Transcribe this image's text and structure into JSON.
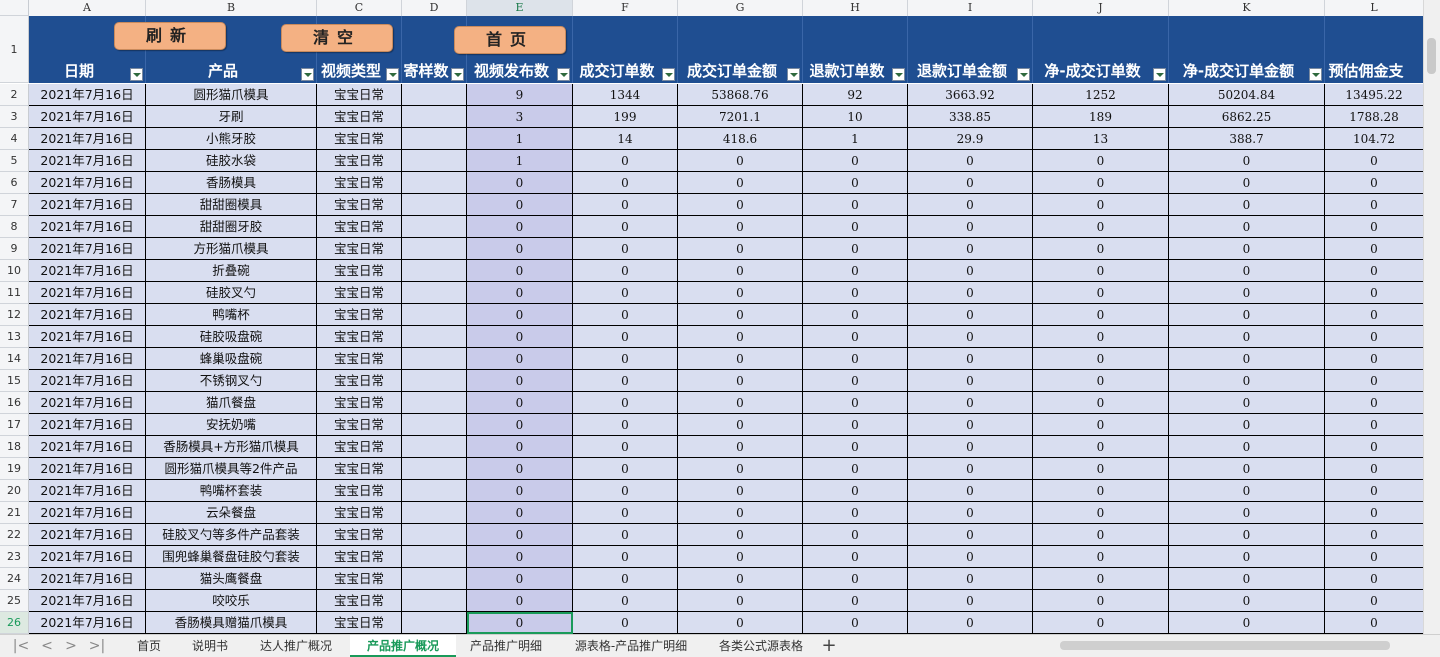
{
  "columns": [
    "A",
    "B",
    "C",
    "D",
    "E",
    "F",
    "G",
    "H",
    "I",
    "J",
    "K",
    "L"
  ],
  "buttons": {
    "refresh": "刷新",
    "clear": "清空",
    "home": "首页"
  },
  "headers": [
    "日期",
    "产品",
    "视频类型",
    "寄样数",
    "视频发布数",
    "成交订单数",
    "成交订单金额",
    "退款订单数",
    "退款订单金额",
    "净-成交订单数",
    "净-成交订单金额",
    "预估佣金支"
  ],
  "header_row_number": "1",
  "rows": [
    {
      "n": "2",
      "date": "2021年7月16日",
      "product": "圆形猫爪模具",
      "type": "宝宝日常",
      "samples": "",
      "videos": "9",
      "orders": "1344",
      "order_amt": "53868.76",
      "refunds": "92",
      "refund_amt": "3663.92",
      "net_orders": "1252",
      "net_amt": "50204.84",
      "commission": "13495.22"
    },
    {
      "n": "3",
      "date": "2021年7月16日",
      "product": "牙刷",
      "type": "宝宝日常",
      "samples": "",
      "videos": "3",
      "orders": "199",
      "order_amt": "7201.1",
      "refunds": "10",
      "refund_amt": "338.85",
      "net_orders": "189",
      "net_amt": "6862.25",
      "commission": "1788.28"
    },
    {
      "n": "4",
      "date": "2021年7月16日",
      "product": "小熊牙胶",
      "type": "宝宝日常",
      "samples": "",
      "videos": "1",
      "orders": "14",
      "order_amt": "418.6",
      "refunds": "1",
      "refund_amt": "29.9",
      "net_orders": "13",
      "net_amt": "388.7",
      "commission": "104.72"
    },
    {
      "n": "5",
      "date": "2021年7月16日",
      "product": "硅胶水袋",
      "type": "宝宝日常",
      "samples": "",
      "videos": "1",
      "orders": "0",
      "order_amt": "0",
      "refunds": "0",
      "refund_amt": "0",
      "net_orders": "0",
      "net_amt": "0",
      "commission": "0"
    },
    {
      "n": "6",
      "date": "2021年7月16日",
      "product": "香肠模具",
      "type": "宝宝日常",
      "samples": "",
      "videos": "0",
      "orders": "0",
      "order_amt": "0",
      "refunds": "0",
      "refund_amt": "0",
      "net_orders": "0",
      "net_amt": "0",
      "commission": "0"
    },
    {
      "n": "7",
      "date": "2021年7月16日",
      "product": "甜甜圈模具",
      "type": "宝宝日常",
      "samples": "",
      "videos": "0",
      "orders": "0",
      "order_amt": "0",
      "refunds": "0",
      "refund_amt": "0",
      "net_orders": "0",
      "net_amt": "0",
      "commission": "0"
    },
    {
      "n": "8",
      "date": "2021年7月16日",
      "product": "甜甜圈牙胶",
      "type": "宝宝日常",
      "samples": "",
      "videos": "0",
      "orders": "0",
      "order_amt": "0",
      "refunds": "0",
      "refund_amt": "0",
      "net_orders": "0",
      "net_amt": "0",
      "commission": "0"
    },
    {
      "n": "9",
      "date": "2021年7月16日",
      "product": "方形猫爪模具",
      "type": "宝宝日常",
      "samples": "",
      "videos": "0",
      "orders": "0",
      "order_amt": "0",
      "refunds": "0",
      "refund_amt": "0",
      "net_orders": "0",
      "net_amt": "0",
      "commission": "0"
    },
    {
      "n": "10",
      "date": "2021年7月16日",
      "product": "折叠碗",
      "type": "宝宝日常",
      "samples": "",
      "videos": "0",
      "orders": "0",
      "order_amt": "0",
      "refunds": "0",
      "refund_amt": "0",
      "net_orders": "0",
      "net_amt": "0",
      "commission": "0"
    },
    {
      "n": "11",
      "date": "2021年7月16日",
      "product": "硅胶叉勺",
      "type": "宝宝日常",
      "samples": "",
      "videos": "0",
      "orders": "0",
      "order_amt": "0",
      "refunds": "0",
      "refund_amt": "0",
      "net_orders": "0",
      "net_amt": "0",
      "commission": "0"
    },
    {
      "n": "12",
      "date": "2021年7月16日",
      "product": "鸭嘴杯",
      "type": "宝宝日常",
      "samples": "",
      "videos": "0",
      "orders": "0",
      "order_amt": "0",
      "refunds": "0",
      "refund_amt": "0",
      "net_orders": "0",
      "net_amt": "0",
      "commission": "0"
    },
    {
      "n": "13",
      "date": "2021年7月16日",
      "product": "硅胶吸盘碗",
      "type": "宝宝日常",
      "samples": "",
      "videos": "0",
      "orders": "0",
      "order_amt": "0",
      "refunds": "0",
      "refund_amt": "0",
      "net_orders": "0",
      "net_amt": "0",
      "commission": "0"
    },
    {
      "n": "14",
      "date": "2021年7月16日",
      "product": "蜂巢吸盘碗",
      "type": "宝宝日常",
      "samples": "",
      "videos": "0",
      "orders": "0",
      "order_amt": "0",
      "refunds": "0",
      "refund_amt": "0",
      "net_orders": "0",
      "net_amt": "0",
      "commission": "0"
    },
    {
      "n": "15",
      "date": "2021年7月16日",
      "product": "不锈钢叉勺",
      "type": "宝宝日常",
      "samples": "",
      "videos": "0",
      "orders": "0",
      "order_amt": "0",
      "refunds": "0",
      "refund_amt": "0",
      "net_orders": "0",
      "net_amt": "0",
      "commission": "0"
    },
    {
      "n": "16",
      "date": "2021年7月16日",
      "product": "猫爪餐盘",
      "type": "宝宝日常",
      "samples": "",
      "videos": "0",
      "orders": "0",
      "order_amt": "0",
      "refunds": "0",
      "refund_amt": "0",
      "net_orders": "0",
      "net_amt": "0",
      "commission": "0"
    },
    {
      "n": "17",
      "date": "2021年7月16日",
      "product": "安抚奶嘴",
      "type": "宝宝日常",
      "samples": "",
      "videos": "0",
      "orders": "0",
      "order_amt": "0",
      "refunds": "0",
      "refund_amt": "0",
      "net_orders": "0",
      "net_amt": "0",
      "commission": "0"
    },
    {
      "n": "18",
      "date": "2021年7月16日",
      "product": "香肠模具+方形猫爪模具",
      "type": "宝宝日常",
      "samples": "",
      "videos": "0",
      "orders": "0",
      "order_amt": "0",
      "refunds": "0",
      "refund_amt": "0",
      "net_orders": "0",
      "net_amt": "0",
      "commission": "0"
    },
    {
      "n": "19",
      "date": "2021年7月16日",
      "product": "圆形猫爪模具等2件产品",
      "type": "宝宝日常",
      "samples": "",
      "videos": "0",
      "orders": "0",
      "order_amt": "0",
      "refunds": "0",
      "refund_amt": "0",
      "net_orders": "0",
      "net_amt": "0",
      "commission": "0"
    },
    {
      "n": "20",
      "date": "2021年7月16日",
      "product": "鸭嘴杯套装",
      "type": "宝宝日常",
      "samples": "",
      "videos": "0",
      "orders": "0",
      "order_amt": "0",
      "refunds": "0",
      "refund_amt": "0",
      "net_orders": "0",
      "net_amt": "0",
      "commission": "0"
    },
    {
      "n": "21",
      "date": "2021年7月16日",
      "product": "云朵餐盘",
      "type": "宝宝日常",
      "samples": "",
      "videos": "0",
      "orders": "0",
      "order_amt": "0",
      "refunds": "0",
      "refund_amt": "0",
      "net_orders": "0",
      "net_amt": "0",
      "commission": "0"
    },
    {
      "n": "22",
      "date": "2021年7月16日",
      "product": "硅胶叉勺等多件产品套装",
      "type": "宝宝日常",
      "samples": "",
      "videos": "0",
      "orders": "0",
      "order_amt": "0",
      "refunds": "0",
      "refund_amt": "0",
      "net_orders": "0",
      "net_amt": "0",
      "commission": "0"
    },
    {
      "n": "23",
      "date": "2021年7月16日",
      "product": "围兜蜂巢餐盘硅胶勺套装",
      "type": "宝宝日常",
      "samples": "",
      "videos": "0",
      "orders": "0",
      "order_amt": "0",
      "refunds": "0",
      "refund_amt": "0",
      "net_orders": "0",
      "net_amt": "0",
      "commission": "0"
    },
    {
      "n": "24",
      "date": "2021年7月16日",
      "product": "猫头鹰餐盘",
      "type": "宝宝日常",
      "samples": "",
      "videos": "0",
      "orders": "0",
      "order_amt": "0",
      "refunds": "0",
      "refund_amt": "0",
      "net_orders": "0",
      "net_amt": "0",
      "commission": "0"
    },
    {
      "n": "25",
      "date": "2021年7月16日",
      "product": "咬咬乐",
      "type": "宝宝日常",
      "samples": "",
      "videos": "0",
      "orders": "0",
      "order_amt": "0",
      "refunds": "0",
      "refund_amt": "0",
      "net_orders": "0",
      "net_amt": "0",
      "commission": "0"
    },
    {
      "n": "26",
      "date": "2021年7月16日",
      "product": "香肠模具赠猫爪模具",
      "type": "宝宝日常",
      "samples": "",
      "videos": "0",
      "orders": "0",
      "order_amt": "0",
      "refunds": "0",
      "refund_amt": "0",
      "net_orders": "0",
      "net_amt": "0",
      "commission": "0"
    }
  ],
  "tabs": [
    "首页",
    "说明书",
    "达人推广概况",
    "产品推广概况",
    "产品推广明细",
    "源表格-产品推广明细",
    "各类公式源表格"
  ],
  "active_tab": "产品推广概况",
  "nav_icons": [
    "first-sheet-icon",
    "prev-sheet-icon",
    "next-sheet-icon",
    "last-sheet-icon"
  ],
  "add_sheet_glyph": "+",
  "colors": {
    "header_bg": "#1f4e91",
    "band_light": "#d9def0",
    "band_dark": "#c9cbea",
    "button": "#f4b183",
    "selection": "#1a9a5a"
  }
}
